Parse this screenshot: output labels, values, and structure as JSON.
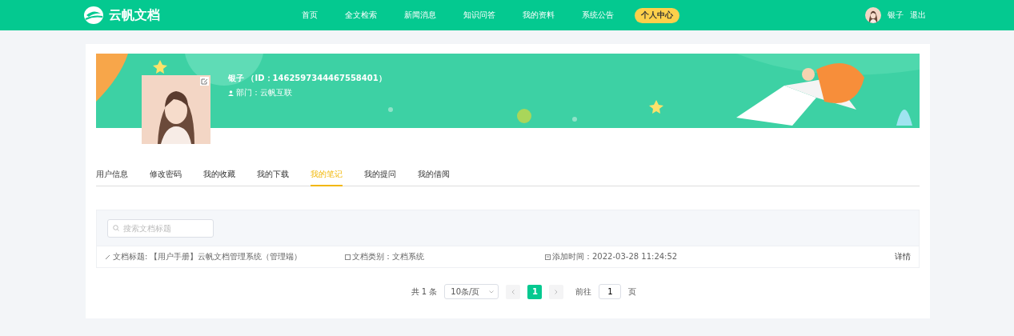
{
  "header": {
    "logo": "云帆文档",
    "nav": [
      {
        "label": "首页",
        "selected": false
      },
      {
        "label": "全文检索",
        "selected": false
      },
      {
        "label": "新闻消息",
        "selected": false
      },
      {
        "label": "知识问答",
        "selected": false
      },
      {
        "label": "我的资料",
        "selected": false
      },
      {
        "label": "系统公告",
        "selected": false
      },
      {
        "label": "个人中心",
        "selected": true
      }
    ],
    "user": "银子",
    "logout": "退出"
  },
  "profile": {
    "name": "银子 （ID：1462597344467558401）",
    "department": "部门：云帆互联"
  },
  "tabs": [
    {
      "label": "用户信息",
      "selected": false
    },
    {
      "label": "修改密码",
      "selected": false
    },
    {
      "label": "我的收藏",
      "selected": false
    },
    {
      "label": "我的下载",
      "selected": false
    },
    {
      "label": "我的笔记",
      "selected": true
    },
    {
      "label": "我的提问",
      "selected": false
    },
    {
      "label": "我的借阅",
      "selected": false
    }
  ],
  "search": {
    "placeholder": "搜索文档标题"
  },
  "rows": [
    {
      "title_label": "文档标题:",
      "title": "【用户手册】云帆文档管理系统（管理端）",
      "category": "文档类别：文档系统",
      "time": "添加时间：2022-03-28 11:24:52",
      "action": "详情"
    }
  ],
  "pagination": {
    "total": "共 1 条",
    "page_size": "10条/页",
    "pages": [
      {
        "label": "1",
        "selected": true
      }
    ],
    "goto_label": "前往",
    "goto_value": "1",
    "page_suffix": "页"
  }
}
